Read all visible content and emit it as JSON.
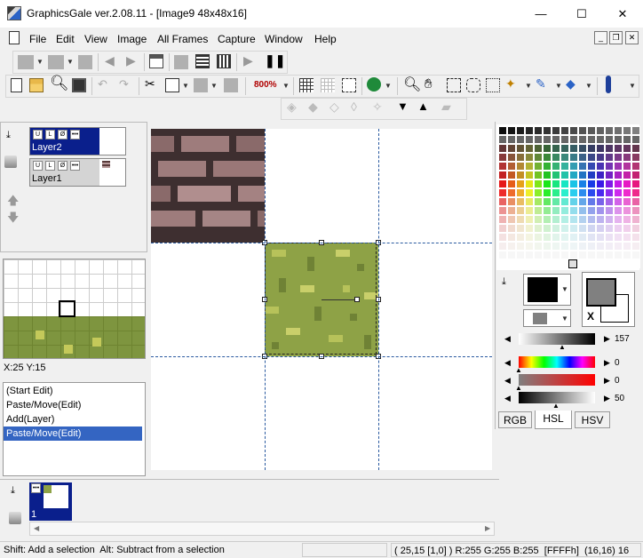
{
  "window": {
    "title": "GraphicsGale ver.2.08.11 - [Image9 48x48x16]",
    "minimize": "—",
    "maximize": "☐",
    "close": "✕"
  },
  "menu": {
    "items": [
      "File",
      "Edit",
      "View",
      "Image",
      "All Frames",
      "Capture",
      "Window",
      "Help"
    ]
  },
  "toolbar": {
    "zoom": "800%"
  },
  "layers": {
    "items": [
      {
        "name": "Layer2",
        "selected": true
      },
      {
        "name": "Layer1",
        "selected": false
      }
    ]
  },
  "preview": {
    "coords": "X:25 Y:15"
  },
  "history": {
    "items": [
      "(Start Edit)",
      "Paste/Move(Edit)",
      "Add(Layer)",
      "Paste/Move(Edit)"
    ],
    "selected_index": 3
  },
  "frames": {
    "items": [
      {
        "number": "1"
      }
    ]
  },
  "color": {
    "sliders": [
      {
        "name": "level",
        "value": "157"
      },
      {
        "name": "hue",
        "value": "0"
      },
      {
        "name": "saturation",
        "value": "0"
      },
      {
        "name": "lightness",
        "value": "50"
      }
    ],
    "tabs": [
      "RGB",
      "HSL",
      "HSV"
    ],
    "active_tab": "HSL",
    "swap_label": "X",
    "primary_color": "#000000",
    "secondary_color": "#808080"
  },
  "status": {
    "hint": "Shift: Add a selection  Alt: Subtract from a selection",
    "pixel_info": "( 25,15 [1,0] ) R:255 G:255 B:255  [FFFFh]  (16,16) 16"
  }
}
